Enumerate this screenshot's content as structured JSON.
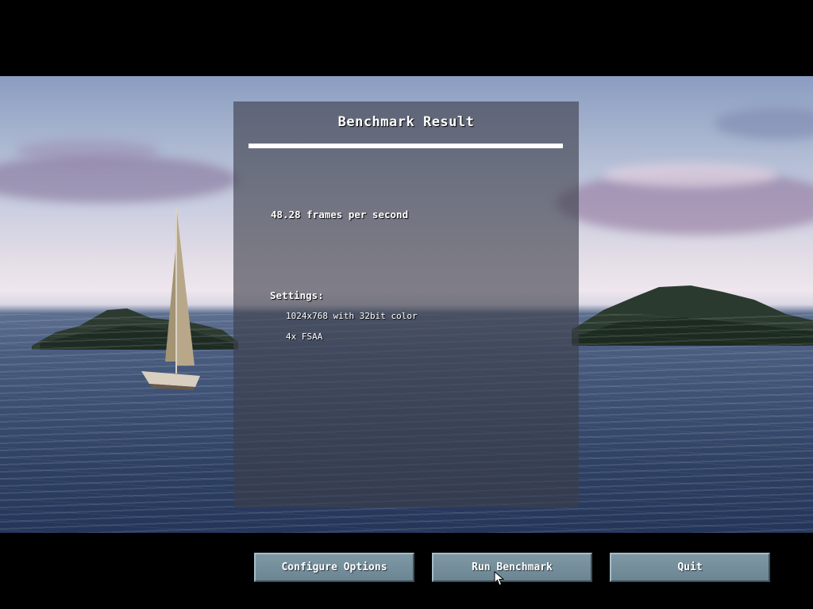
{
  "panel": {
    "title": "Benchmark Result",
    "fps_text": "48.28 frames per second",
    "settings_label": "Settings:",
    "settings": [
      "1024x768 with 32bit color",
      "4x FSAA"
    ]
  },
  "buttons": {
    "configure": "Configure Options",
    "run": "Run Benchmark",
    "quit": "Quit"
  },
  "colors": {
    "button": "#7390a0",
    "panel": "#3c3e48",
    "rule": "#ffffff"
  },
  "icons": {
    "cursor": "arrow-cursor-icon"
  }
}
